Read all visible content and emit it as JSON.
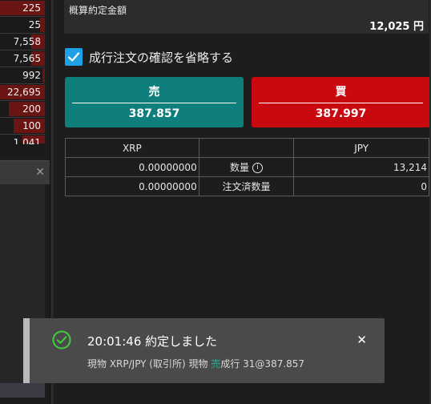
{
  "order_book": {
    "rows": [
      {
        "value": "225",
        "fill": 1.0
      },
      {
        "value": "25",
        "fill": 0.1
      },
      {
        "value": "7,558",
        "fill": 0.3
      },
      {
        "value": "7,565",
        "fill": 0.3
      },
      {
        "value": "992",
        "fill": 0.05
      },
      {
        "value": "22,695",
        "fill": 1.0
      },
      {
        "value": "200",
        "fill": 0.8
      },
      {
        "value": "100",
        "fill": 0.7
      },
      {
        "value": "1,041",
        "fill": 0.5
      }
    ]
  },
  "estimate": {
    "label": "概算約定金額",
    "value": "12,025 円"
  },
  "skip_confirm": {
    "checked": true,
    "label": "成行注文の確認を省略する"
  },
  "sell_button": {
    "title": "売",
    "price": "387.857",
    "color": "#0f7f7d"
  },
  "buy_button": {
    "title": "買",
    "price": "387.997",
    "color": "#c8090f"
  },
  "balance_table": {
    "headers": [
      "XRP",
      "",
      "JPY"
    ],
    "rows": [
      {
        "left": "0.00000000",
        "label": "数量",
        "has_info": true,
        "right": "13,214"
      },
      {
        "left": "0.00000000",
        "label": "注文済数量",
        "has_info": false,
        "right": "0"
      }
    ]
  },
  "toast": {
    "title": "20:01:46 約定しました",
    "detail_prefix": "現物 XRP/JPY (取引所) 現物",
    "detail_side": "売",
    "detail_suffix": "成行 31@387.857",
    "icon": "check-circle-icon",
    "side_color": "#19b39c"
  }
}
